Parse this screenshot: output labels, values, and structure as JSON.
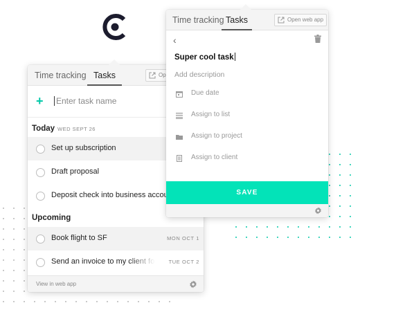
{
  "colors": {
    "accent": "#03e3b8",
    "brand": "#1c1c2e",
    "dots_gray": "#b7b7b7",
    "dots_teal": "#03c9a9"
  },
  "logo": {
    "icon": "clockify-logo"
  },
  "back_panel": {
    "tabs": [
      {
        "label": "Time tracking",
        "active": false
      },
      {
        "label": "Tasks",
        "active": true
      }
    ],
    "open_web_label": "Open web app",
    "add_task": {
      "icon": "plus-icon",
      "placeholder": "Enter task name"
    },
    "today": {
      "label": "Today",
      "date": "WED SEPT 26"
    },
    "today_tasks": [
      {
        "label": "Set up subscription"
      },
      {
        "label": "Draft proposal"
      },
      {
        "label": "Deposit check into business account"
      }
    ],
    "upcoming": {
      "label": "Upcoming"
    },
    "upcoming_tasks": [
      {
        "label": "Book flight to SF",
        "date": "MON OCT 1"
      },
      {
        "label": "Send an invoice to my client for the",
        "date": "TUE OCT 2"
      }
    ],
    "footer": {
      "link": "View in web app",
      "icon": "gear-icon"
    }
  },
  "front_panel": {
    "tabs": [
      {
        "label": "Time tracking",
        "active": false
      },
      {
        "label": "Tasks",
        "active": true
      }
    ],
    "open_web_label": "Open web app",
    "task_title": "Super cool task",
    "description_placeholder": "Add description",
    "fields": [
      {
        "label": "Due date",
        "icon": "calendar-icon"
      },
      {
        "label": "Assign to list",
        "icon": "list-icon"
      },
      {
        "label": "Assign to project",
        "icon": "folder-icon"
      },
      {
        "label": "Assign to client",
        "icon": "client-icon"
      }
    ],
    "save_label": "SAVE",
    "footer": {
      "icon": "gear-icon"
    }
  }
}
